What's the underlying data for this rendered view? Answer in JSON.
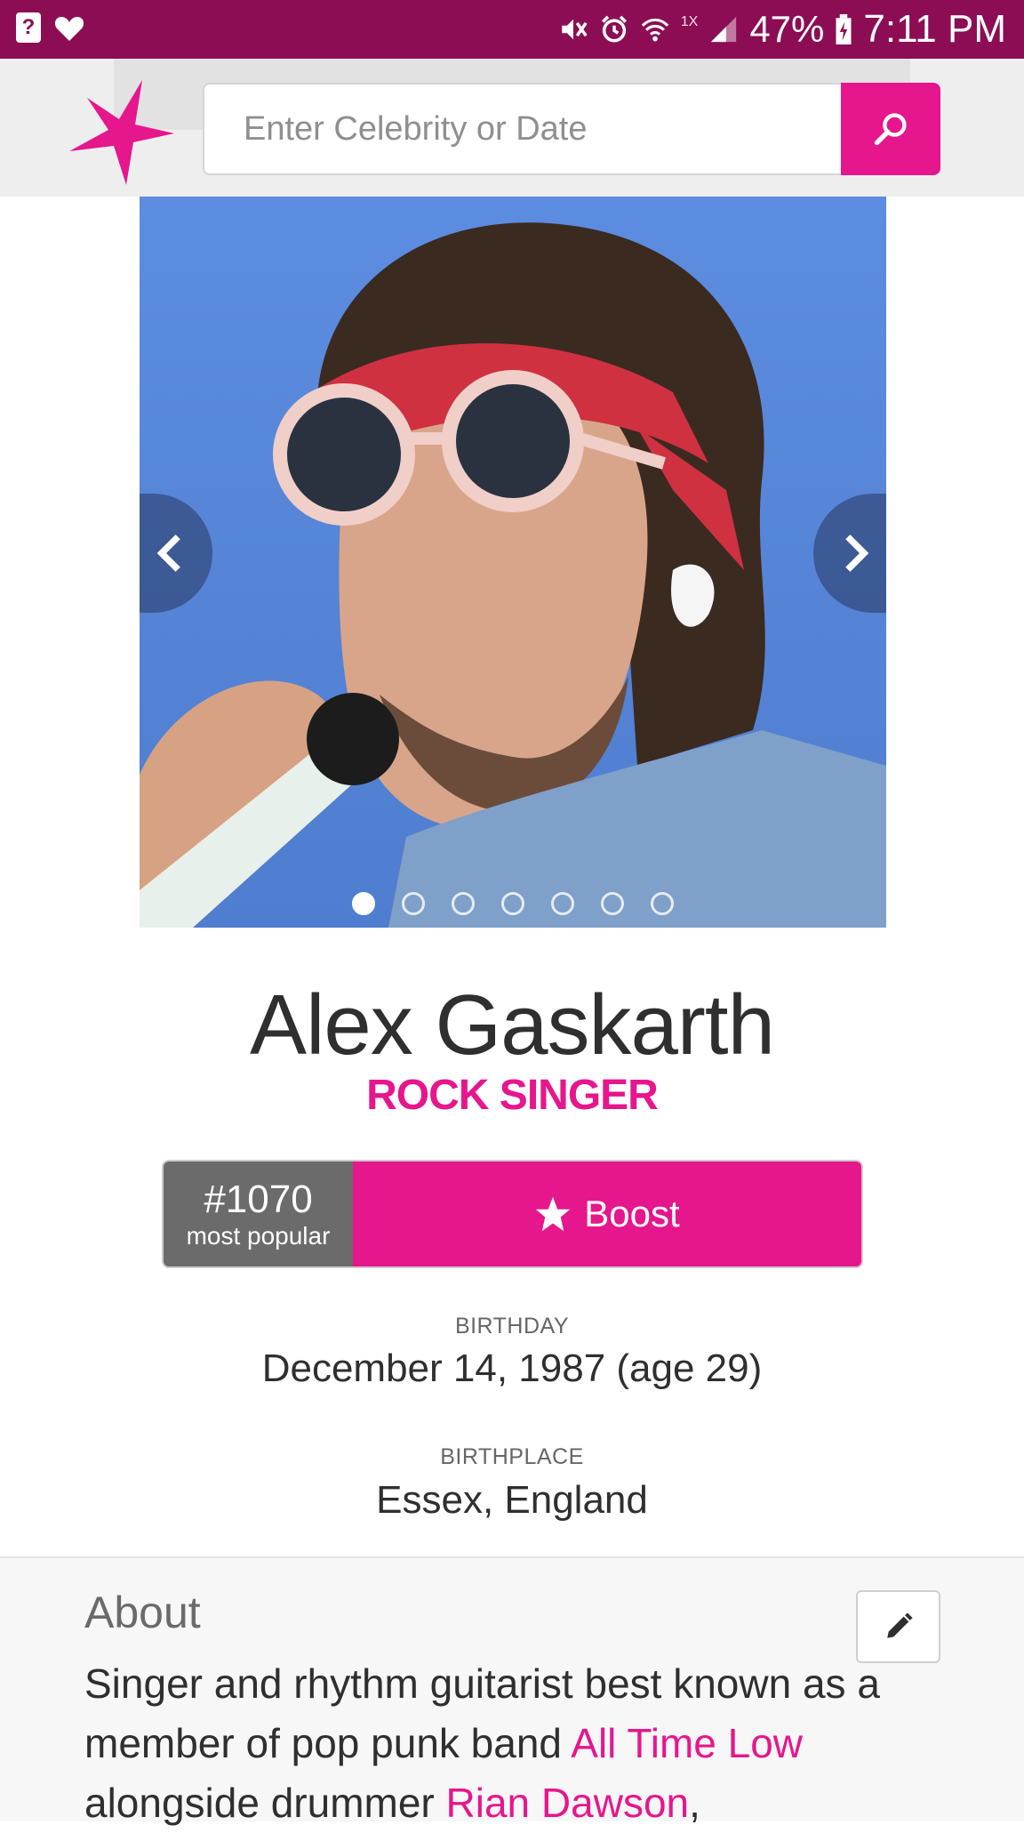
{
  "status_bar": {
    "notification_icons": [
      "question-box-icon",
      "heart-icon"
    ],
    "system_icons": [
      "mute-icon",
      "alarm-icon",
      "wifi-icon",
      "signal-icon",
      "battery-charging-icon"
    ],
    "wifi_rate": "1X",
    "battery_percent": "47%",
    "time": "7:11 PM"
  },
  "header": {
    "logo_icon": "star-logo-icon",
    "search": {
      "placeholder": "Enter Celebrity or Date",
      "value": "",
      "button_icon": "search-icon"
    }
  },
  "carousel": {
    "image_alt": "Photo of a man with a red bandana and round sunglasses singing into a microphone",
    "prev_icon": "chevron-left-icon",
    "next_icon": "chevron-right-icon",
    "slide_count": 7,
    "active_slide": 1
  },
  "profile": {
    "name": "Alex Gaskarth",
    "profession": "ROCK SINGER",
    "rank": "#1070",
    "rank_label": "most popular",
    "boost_label": "Boost",
    "boost_icon": "star-icon"
  },
  "facts": {
    "birthday_label": "BIRTHDAY",
    "birthday_value": "December 14, 1987 (age 29)",
    "birthplace_label": "BIRTHPLACE",
    "birthplace_value": "Essex, England"
  },
  "about": {
    "title": "About",
    "edit_icon": "pencil-icon",
    "text_1": "Singer and rhythm guitarist best known as a member of pop punk band ",
    "link_band": "All Time Low",
    "text_2": " alongside drummer ",
    "link_drummer": "Rian Dawson",
    "text_3": ","
  },
  "colors": {
    "brand_pink": "#e6168d",
    "status_bar": "#8c0d54",
    "rank_gray": "#6b6b6b"
  }
}
